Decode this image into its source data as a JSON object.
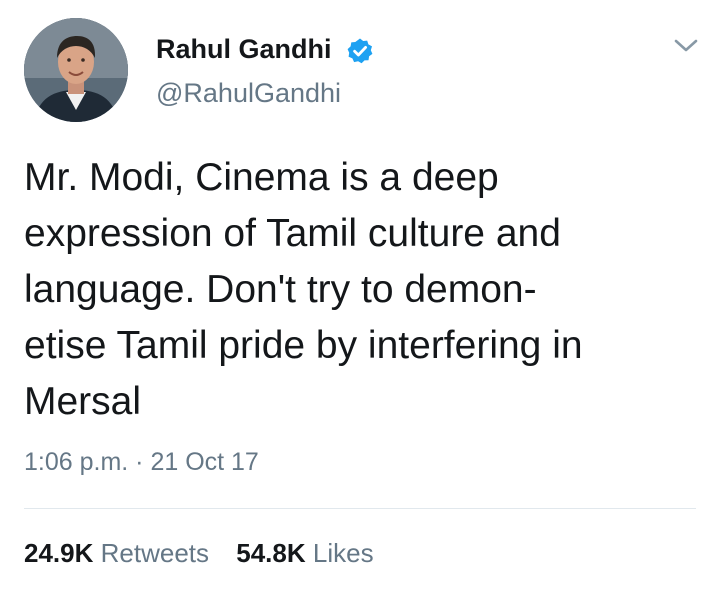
{
  "user": {
    "display_name": "Rahul Gandhi",
    "handle": "@RahulGandhi",
    "verified": true,
    "avatar_icon": "profile-photo"
  },
  "tweet": {
    "text": "Mr. Modi, Cinema is a deep\nexpression of Tamil culture and\nlanguage. Don't try to demon-\netise Tamil pride by interfering in\nMersal",
    "timestamp": "1:06 p.m. · 21 Oct 17"
  },
  "stats": {
    "retweets_count": "24.9K",
    "retweets_label": "Retweets",
    "likes_count": "54.8K",
    "likes_label": "Likes"
  },
  "colors": {
    "verified_blue": "#1da1f2",
    "secondary_text": "#657786",
    "primary_text": "#14171a",
    "divider": "#e1e8ed"
  },
  "icons": {
    "verified": "verified-badge-icon",
    "menu": "chevron-down-icon"
  }
}
